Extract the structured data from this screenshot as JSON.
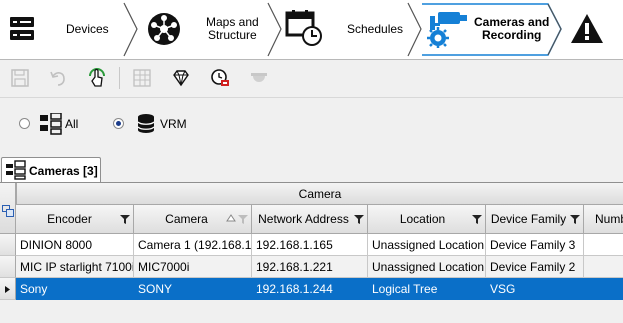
{
  "nav": {
    "items": [
      {
        "label": "Devices",
        "icon": "server-icon"
      },
      {
        "label": "Maps and\nStructure",
        "icon": "network-hub-icon"
      },
      {
        "label": "Schedules",
        "icon": "calendar-clock-icon"
      },
      {
        "label": "Cameras and\nRecording",
        "icon": "camera-gear-icon",
        "active": true
      },
      {
        "label": "",
        "icon": "warning-icon"
      }
    ]
  },
  "toolbar": {
    "buttons": [
      "save-icon",
      "undo-icon",
      "touch-refresh-icon",
      "table-config-icon",
      "diamond-icon",
      "schedule-record-icon",
      "dome-camera-icon"
    ]
  },
  "filter": {
    "options": [
      {
        "label": "All",
        "checked": false
      },
      {
        "label": "VRM",
        "checked": true
      }
    ]
  },
  "tab": {
    "label": "Cameras [3]"
  },
  "grid": {
    "group_header": "Camera",
    "columns": [
      "Encoder",
      "Camera",
      "Network Address",
      "Location",
      "Device Family",
      "Numb"
    ],
    "rows": [
      {
        "cells": [
          "DINION 8000",
          "Camera 1 (192.168.1.",
          "192.168.1.165",
          "Unassigned Location",
          "Device Family 3",
          ""
        ]
      },
      {
        "cells": [
          "MIC IP starlight 7100i",
          "MIC7000i",
          "192.168.1.221",
          "Unassigned Location",
          "Device Family 2",
          ""
        ]
      },
      {
        "cells": [
          "Sony",
          "SONY",
          "192.168.1.244",
          "Logical Tree",
          "VSG",
          ""
        ],
        "selected": true
      }
    ]
  },
  "colors": {
    "selection": "#0a6fc8",
    "accent": "#1580d6"
  }
}
